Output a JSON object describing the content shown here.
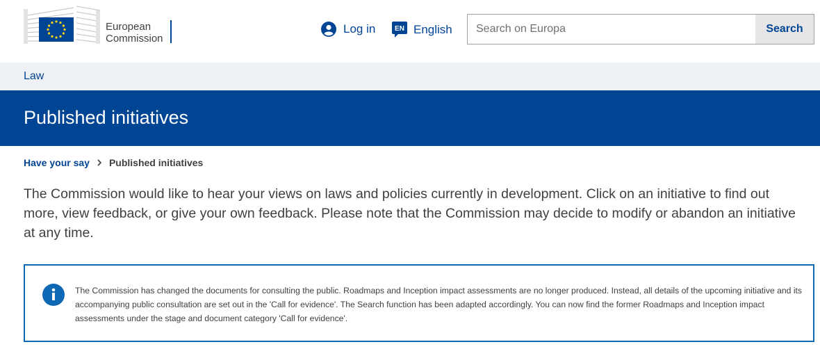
{
  "header": {
    "logo_line1": "European",
    "logo_line2": "Commission",
    "login_label": "Log in",
    "lang_code": "EN",
    "lang_label": "English",
    "search_placeholder": "Search on Europa",
    "search_button": "Search"
  },
  "site_name": "Law",
  "page_title": "Published initiatives",
  "breadcrumb": {
    "parent": "Have your say",
    "current": "Published initiatives"
  },
  "intro": "The Commission would like to hear your views on laws and policies currently in development. Click on an initiative to find out more, view feedback, or give your own feedback. Please note that the Commission may decide to modify or abandon an initiative at any time.",
  "info_message": "The Commission has changed the documents for consulting the public. Roadmaps and Inception impact assessments are no longer produced. Instead, all details of the upcoming initiative and its accompanying public consultation are set out in the 'Call for evidence'. The Search function has been adapted accordingly. You can now find the former Roadmaps and Inception impact assessments under the stage and document category 'Call for evidence'.",
  "icons": {
    "logo": "eu-flag-building-logo",
    "login": "user-icon",
    "language": "speech-bubble-icon",
    "breadcrumb_separator": "chevron-right-icon",
    "info": "info-icon"
  },
  "colors": {
    "primary": "#004494",
    "info_border": "#0e68b4",
    "strip_bg": "#eef1f5",
    "text": "#404040"
  }
}
